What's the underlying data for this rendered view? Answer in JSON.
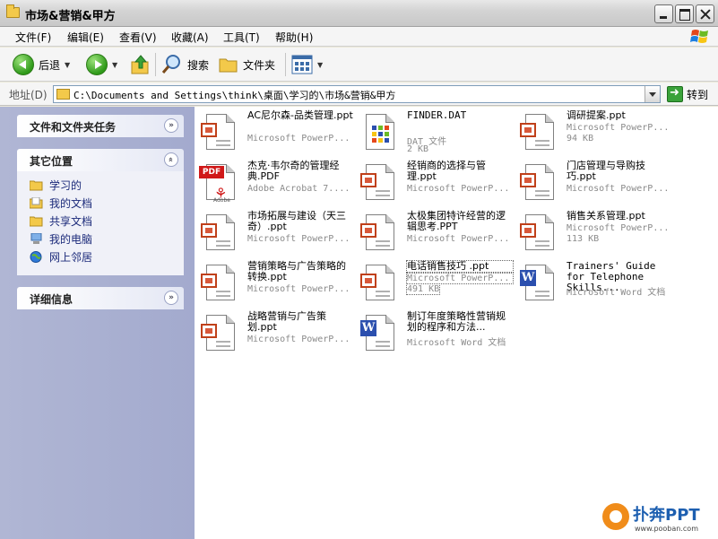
{
  "window": {
    "title": "市场&营销&甲方"
  },
  "menu": [
    {
      "label": "文件(F)"
    },
    {
      "label": "编辑(E)"
    },
    {
      "label": "查看(V)"
    },
    {
      "label": "收藏(A)"
    },
    {
      "label": "工具(T)"
    },
    {
      "label": "帮助(H)"
    }
  ],
  "toolbar": {
    "back_label": "后退",
    "search_label": "搜索",
    "folders_label": "文件夹"
  },
  "address": {
    "label": "地址(D)",
    "path": "C:\\Documents and Settings\\think\\桌面\\学习的\\市场&营销&甲方",
    "go_label": "转到"
  },
  "sidebar": {
    "tasks_title": "文件和文件夹任务",
    "places_title": "其它位置",
    "places": [
      {
        "label": "学习的",
        "icon": "folder-icon"
      },
      {
        "label": "我的文档",
        "icon": "my-documents-icon"
      },
      {
        "label": "共享文档",
        "icon": "shared-documents-icon"
      },
      {
        "label": "我的电脑",
        "icon": "my-computer-icon"
      },
      {
        "label": "网上邻居",
        "icon": "network-places-icon"
      }
    ],
    "details_title": "详细信息"
  },
  "files": [
    {
      "name": "AC尼尔森-品类管理.ppt",
      "type": "Microsoft PowerP...",
      "size": "",
      "icon": "ppt"
    },
    {
      "name": "FINDER.DAT",
      "type": "DAT 文件",
      "size": "2 KB",
      "icon": "dat"
    },
    {
      "name": "调研提案.ppt",
      "type": "Microsoft PowerP...",
      "size": "94 KB",
      "icon": "ppt"
    },
    {
      "name": "杰克·韦尔奇的管理经典.PDF",
      "type": "Adobe Acrobat 7....",
      "size": "",
      "icon": "pdf"
    },
    {
      "name": "经销商的选择与管理.ppt",
      "type": "Microsoft PowerP...",
      "size": "",
      "icon": "ppt"
    },
    {
      "name": "门店管理与导购技巧.ppt",
      "type": "Microsoft PowerP...",
      "size": "",
      "icon": "ppt"
    },
    {
      "name": "市场拓展与建设（天三奇）.ppt",
      "type": "Microsoft PowerP...",
      "size": "",
      "icon": "ppt"
    },
    {
      "name": "太极集团特许经营的逻辑思考.PPT",
      "type": "Microsoft PowerP...",
      "size": "",
      "icon": "ppt"
    },
    {
      "name": "销售关系管理.ppt",
      "type": "Microsoft PowerP...",
      "size": "113 KB",
      "icon": "ppt"
    },
    {
      "name": "营销策略与广告策略的转换.ppt",
      "type": "Microsoft PowerP...",
      "size": "",
      "icon": "ppt"
    },
    {
      "name": "电话销售技巧 .ppt",
      "type": "Microsoft PowerP...",
      "size": "491 KB",
      "icon": "ppt"
    },
    {
      "name": "Trainers' Guide for Telephone Skills...",
      "type": "Microsoft Word 文档",
      "size": "",
      "icon": "word"
    },
    {
      "name": "战略营销与广告策划.ppt",
      "type": "Microsoft PowerP...",
      "size": "",
      "icon": "ppt"
    },
    {
      "name": "制订年度策略性营销规划的程序和方法...",
      "type": "Microsoft Word 文档",
      "size": "",
      "icon": "word"
    }
  ],
  "watermark": {
    "brand": "扑奔PPT",
    "url": "www.pooban.com"
  }
}
